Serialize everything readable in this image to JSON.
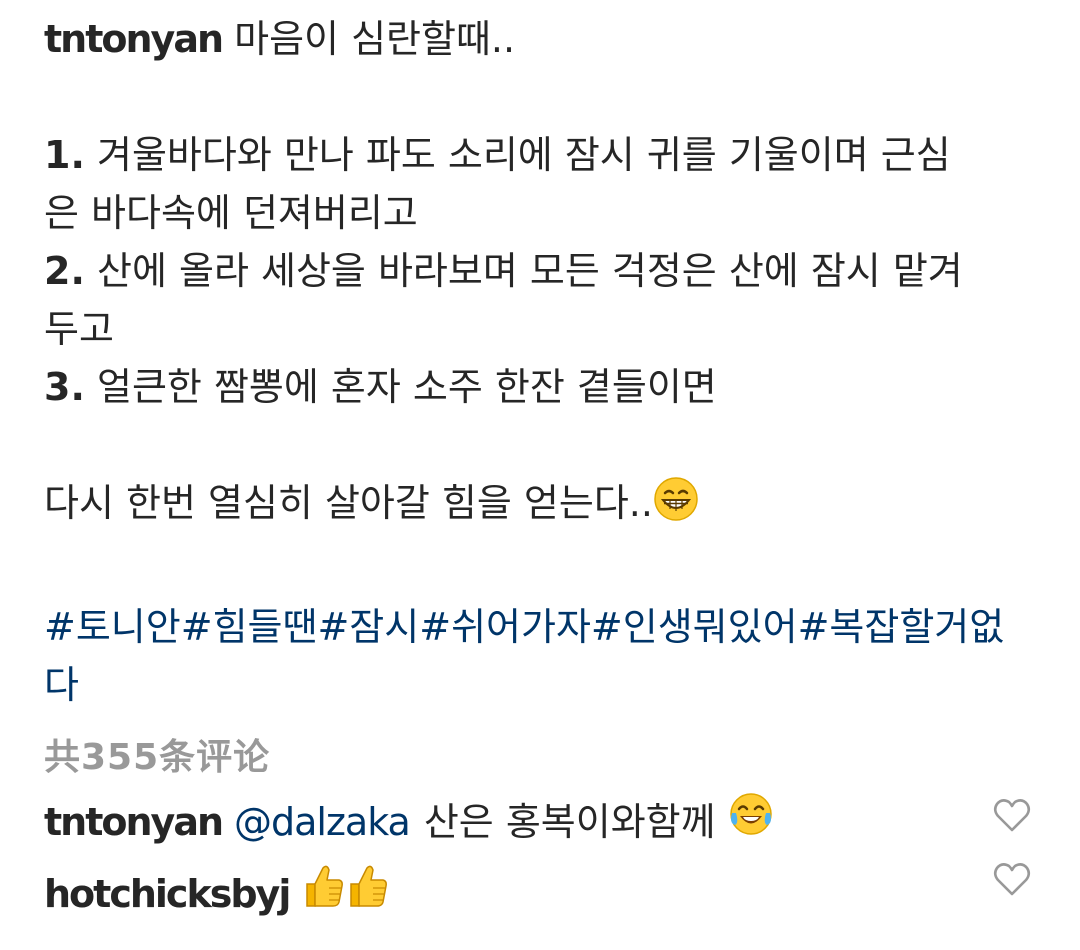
{
  "post": {
    "username": "tntonyan",
    "caption_title": "마음이 심란할때..",
    "items": [
      {
        "num": "1.",
        "text": "겨울바다와 만나 파도 소리에 잠시 귀를 기울이며 근심",
        "cont": "은 바다속에 던져버리고"
      },
      {
        "num": "2.",
        "text": "산에 올라 세상을 바라보며 모든 걱정은 산에 잠시 맡겨",
        "cont": "두고"
      },
      {
        "num": "3.",
        "text": "얼큰한 짬뽕에 혼자 소주 한잔 곁들이면",
        "cont": ""
      }
    ],
    "closing": "다시 한번 열심히 살아갈 힘을 얻는다..",
    "closing_emoji": "grinning-face-emoji",
    "hashtags": [
      "#토니안",
      "#힘들땐",
      "#잠시",
      "#쉬어가자",
      "#인생뭐있어",
      "#복잡할거없다"
    ]
  },
  "view_comments": "共355条评论",
  "comments": [
    {
      "username": "tntonyan",
      "mention": "@dalzaka",
      "text": "산은 홍복이와함께",
      "emoji": "tears-of-joy-emoji"
    },
    {
      "username": "hotchicksbyj",
      "mention": "",
      "text": "",
      "emoji": "thumbs-up-emoji-x2"
    }
  ],
  "colors": {
    "text": "#262626",
    "link": "#003569",
    "muted": "#999999"
  }
}
